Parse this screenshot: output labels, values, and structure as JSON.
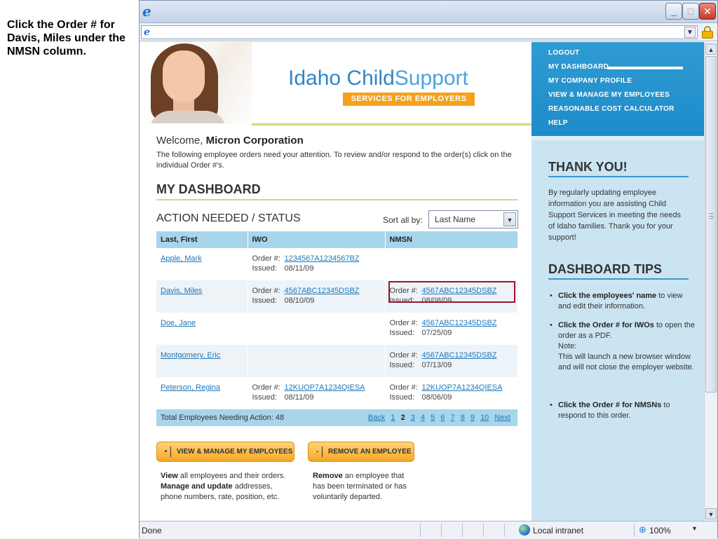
{
  "instruction": "Click the Order # for Davis, Miles under the NMSN column.",
  "browser": {
    "status_text": "Done",
    "zone": "Local intranet",
    "zoom": "100%"
  },
  "brand": {
    "title_part1": "Idaho Child",
    "title_part2": "Support",
    "subtitle": "SERVICES FOR EMPLOYERS"
  },
  "nav": {
    "items": [
      "LOGOUT",
      "MY DASHBOARD",
      "MY COMPANY PROFILE",
      "VIEW & MANAGE MY EMPLOYEES",
      "REASONABLE COST CALCULATOR",
      "HELP"
    ]
  },
  "welcome": {
    "prefix": "Welcome,",
    "company": "Micron Corporation",
    "intro": "The following employee orders need your attention. To review and/or respond to the order(s) click on the individual Order #'s."
  },
  "dashboard": {
    "title": "MY DASHBOARD",
    "section_title": "ACTION NEEDED / STATUS",
    "sort_label": "Sort all by:",
    "sort_value": "Last Name",
    "columns": [
      "Last, First",
      "IWO",
      "NMSN"
    ],
    "order_label": "Order #:",
    "issued_label": "Issued:",
    "rows": [
      {
        "name": "Apple, Mark",
        "iwo_order": "1234567A1234567BZ",
        "iwo_issued": "08/11/09",
        "nmsn_order": "",
        "nmsn_issued": ""
      },
      {
        "name": "Davis, Miles",
        "iwo_order": "4567ABC12345DSBZ",
        "iwo_issued": "08/10/09",
        "nmsn_order": "4567ABC12345DSBZ",
        "nmsn_issued": "08/08/09"
      },
      {
        "name": "Doe, Jane",
        "iwo_order": "",
        "iwo_issued": "",
        "nmsn_order": "4567ABC12345DSBZ",
        "nmsn_issued": "07/25/09"
      },
      {
        "name": "Montgomery, Eric",
        "iwo_order": "",
        "iwo_issued": "",
        "nmsn_order": "4567ABC12345DSBZ",
        "nmsn_issued": "07/13/09"
      },
      {
        "name": "Peterson, Regina",
        "iwo_order": "12KUOP7A1234QIESA",
        "iwo_issued": "08/11/09",
        "nmsn_order": "12KUOP7A1234QIESA",
        "nmsn_issued": "08/06/09"
      }
    ],
    "total_label": "Total Employees Needing Action: 48",
    "pager": {
      "back": "Back",
      "pages": [
        "1",
        "2",
        "3",
        "4",
        "5",
        "6",
        "7",
        "8",
        "9",
        "10"
      ],
      "current": "2",
      "next": "Next"
    }
  },
  "buttons": {
    "view_manage": "VIEW & MANAGE MY EMPLOYEES",
    "view_icon": "•",
    "remove": "REMOVE AN EMPLOYEE",
    "remove_icon": "-"
  },
  "descriptions": {
    "view_bold1": "View",
    "view_text1": " all employees and their orders. ",
    "view_bold2": "Manage and update",
    "view_text2": " addresses, phone numbers, rate, position, etc.",
    "remove_bold": "Remove",
    "remove_text": " an employee that has been terminated or has voluntarily departed."
  },
  "sidebar": {
    "thanks_title": "THANK YOU!",
    "thanks_text": "By regularly updating employee information you are assisting Child Support Services in meeting the needs of Idaho families. Thank you for your support!",
    "tips_title": "DASHBOARD TIPS",
    "tip1_bold": "Click the employees' name",
    "tip1_text": " to view and edit their information.",
    "tip2_bold": "Click the Order # for IWOs",
    "tip2_text": " to open the order as a PDF.",
    "tip2_note_label": "Note:",
    "tip2_note": "This will launch a new browser window and will not close the employer website.",
    "tip3_bold": "Click the Order # for NMSNs",
    "tip3_text": " to respond to this order."
  },
  "icons": {
    "browser": "ie-icon",
    "security": "lock-icon",
    "zone": "globe-icon",
    "zoom": "zoom-icon"
  },
  "colors": {
    "nav_bg": "#2f9bd3",
    "sidebar_bg": "#cbe4f2",
    "table_header": "#a7d5ec",
    "accent_orange": "#f4a21e",
    "accent_green": "#c7dd7c",
    "link": "#1f77b8",
    "highlight": "#a0142e"
  }
}
